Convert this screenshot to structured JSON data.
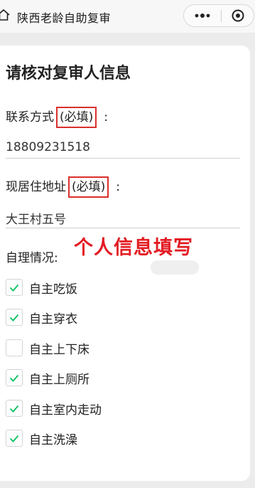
{
  "nav": {
    "title": "陕西老龄自助复审",
    "home_icon": "home-icon",
    "more_icon": "more-dots-icon",
    "close_icon": "target-close-icon"
  },
  "form": {
    "heading": "请核对复审人信息",
    "contact": {
      "label": "联系方式",
      "required": "(必填)",
      "colon": ":",
      "value": "18809231518"
    },
    "address": {
      "label": "现居住地址",
      "required": "(必填)",
      "colon": ":",
      "value": "大王村五号"
    },
    "self_care": {
      "label": "自理情况:",
      "options": [
        {
          "label": "自主吃饭",
          "checked": true
        },
        {
          "label": "自主穿衣",
          "checked": true
        },
        {
          "label": "自主上下床",
          "checked": false
        },
        {
          "label": "自主上厕所",
          "checked": true
        },
        {
          "label": "自主室内走动",
          "checked": true
        },
        {
          "label": "自主洗澡",
          "checked": true
        }
      ]
    }
  },
  "annotation": "个人信息填写",
  "colors": {
    "check": "#07c160",
    "highlight": "#d9302c",
    "annotation": "#e31b23"
  }
}
